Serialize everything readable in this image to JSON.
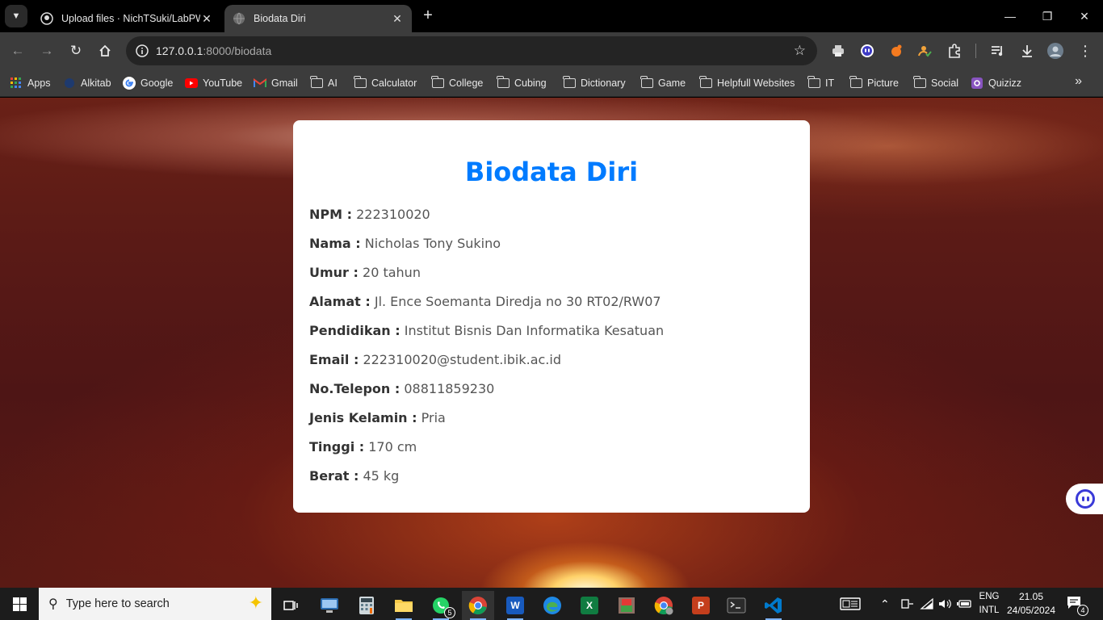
{
  "browser": {
    "tabs": [
      {
        "title": "Upload files · NichTSuki/LabPW",
        "active": false,
        "icon": "github-icon"
      },
      {
        "title": "Biodata Diri",
        "active": true,
        "icon": "globe-icon"
      }
    ],
    "url_host": "127.0.0.1",
    "url_rest": ":8000/biodata",
    "bookmarks": [
      {
        "label": "Apps",
        "icon": "apps-grid-icon"
      },
      {
        "label": "Alkitab",
        "icon": "alkitab-icon"
      },
      {
        "label": "Google",
        "icon": "google-icon"
      },
      {
        "label": "YouTube",
        "icon": "youtube-icon"
      },
      {
        "label": "Gmail",
        "icon": "gmail-icon"
      },
      {
        "label": "AI",
        "icon": "folder-icon"
      },
      {
        "label": "Calculator",
        "icon": "folder-icon"
      },
      {
        "label": "College",
        "icon": "folder-icon"
      },
      {
        "label": "Cubing",
        "icon": "folder-icon"
      },
      {
        "label": "Dictionary",
        "icon": "folder-icon"
      },
      {
        "label": "Game",
        "icon": "folder-icon"
      },
      {
        "label": "Helpfull Websites",
        "icon": "folder-icon"
      },
      {
        "label": "IT",
        "icon": "folder-icon"
      },
      {
        "label": "Picture",
        "icon": "folder-icon"
      },
      {
        "label": "Social",
        "icon": "folder-icon"
      },
      {
        "label": "Quizizz",
        "icon": "quizizz-icon"
      }
    ]
  },
  "page": {
    "heading": "Biodata Diri",
    "fields": [
      {
        "label": "NPM :",
        "value": "222310020"
      },
      {
        "label": "Nama :",
        "value": "Nicholas Tony Sukino"
      },
      {
        "label": "Umur :",
        "value": "20 tahun"
      },
      {
        "label": "Alamat :",
        "value": "Jl. Ence Soemanta Diredja no 30 RT02/RW07"
      },
      {
        "label": "Pendidikan :",
        "value": "Institut Bisnis Dan Informatika Kesatuan"
      },
      {
        "label": "Email :",
        "value": "222310020@student.ibik.ac.id"
      },
      {
        "label": "No.Telepon :",
        "value": "08811859230"
      },
      {
        "label": "Jenis Kelamin :",
        "value": "Pria"
      },
      {
        "label": "Tinggi :",
        "value": "170 cm"
      },
      {
        "label": "Berat :",
        "value": "45 kg"
      }
    ],
    "heading_color": "#007bff"
  },
  "taskbar": {
    "search_placeholder": "Type here to search",
    "whatsapp_badge": "5",
    "lang_line1": "ENG",
    "lang_line2": "INTL",
    "time": "21.05",
    "date": "24/05/2024",
    "notification_count": "4"
  }
}
